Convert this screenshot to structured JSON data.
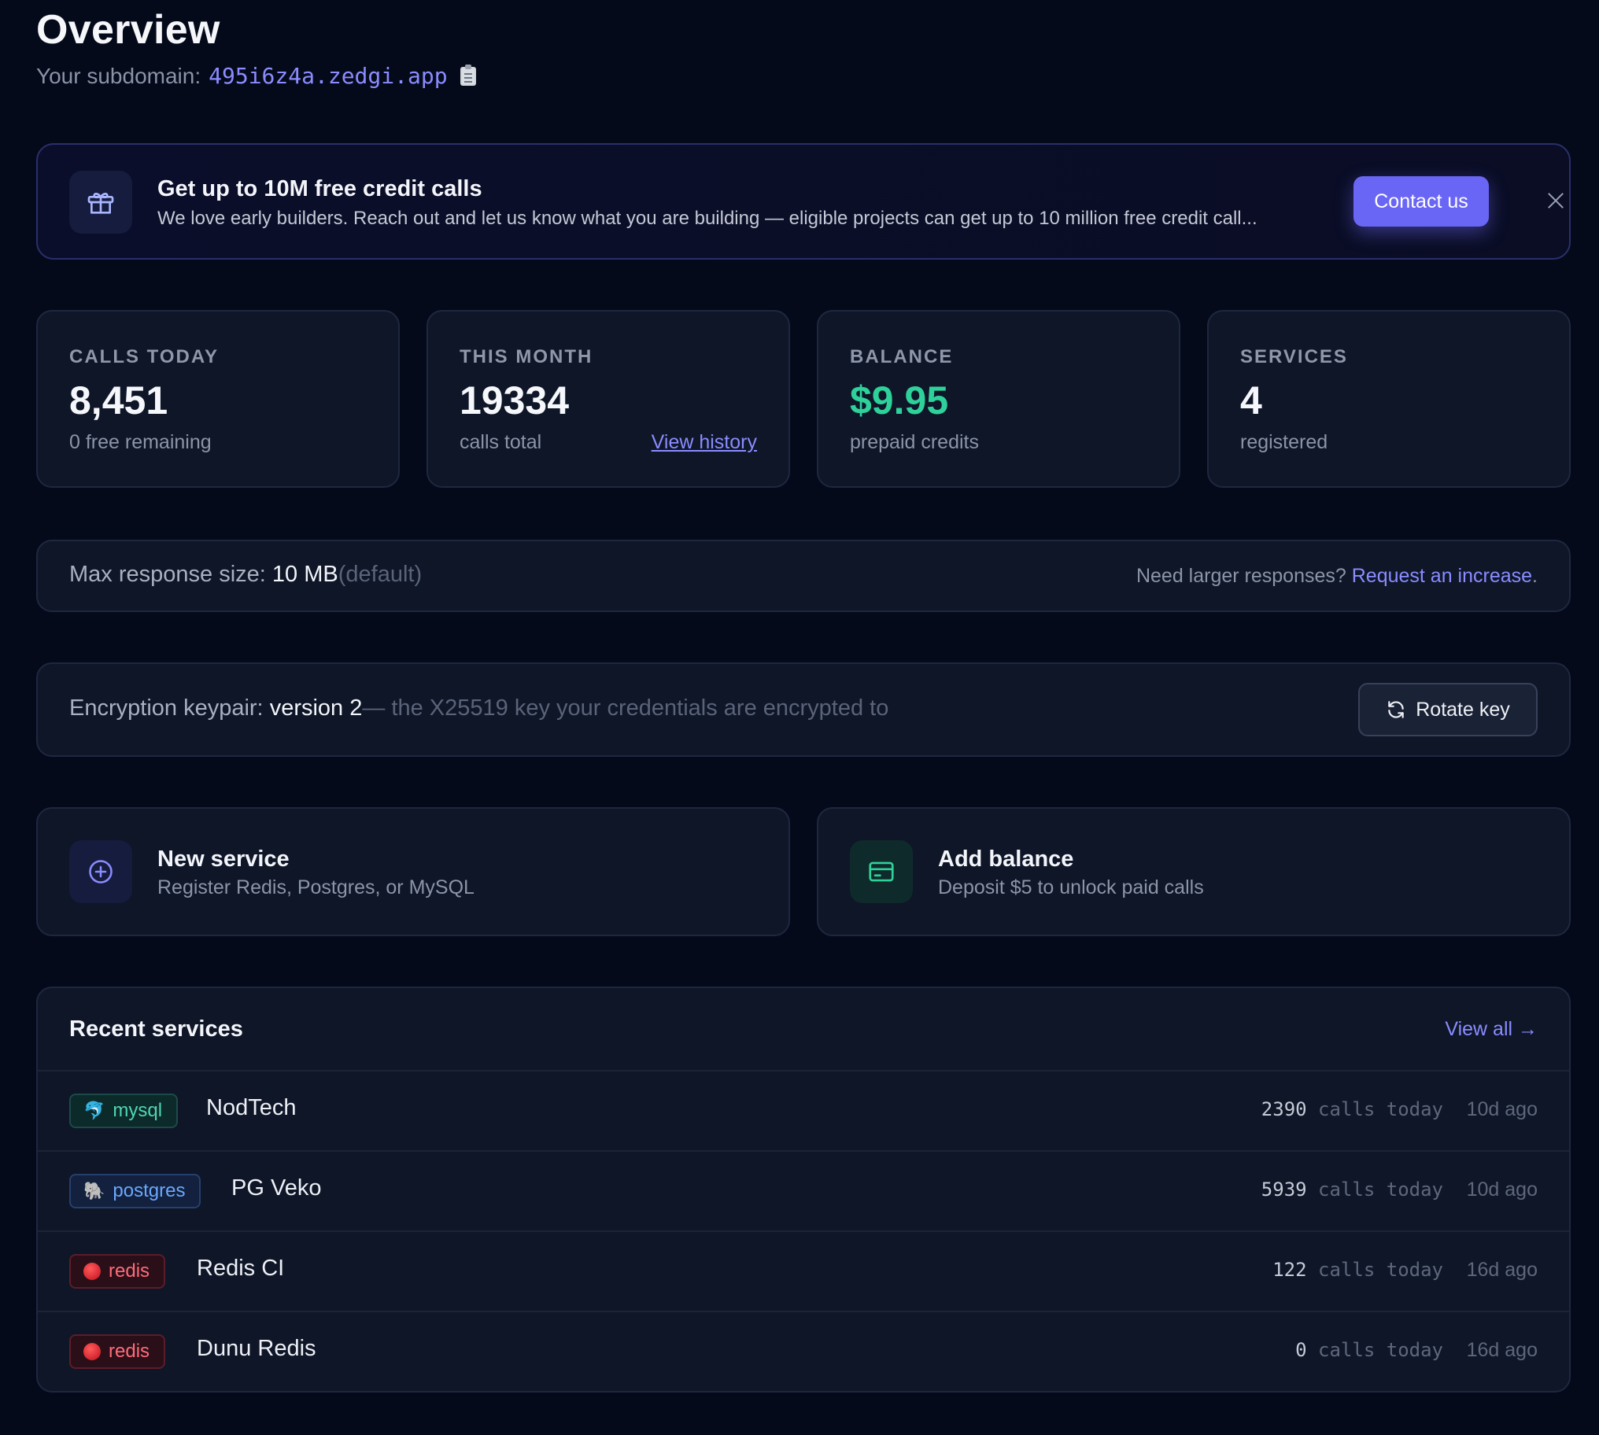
{
  "header": {
    "title": "Overview",
    "subdomain_label": "Your subdomain:",
    "subdomain": "495i6z4a.zedgi.app"
  },
  "promo": {
    "title": "Get up to 10M free credit calls",
    "text": "We love early builders. Reach out and let us know what you are building — eligible projects can get up to 10 million free credit call...",
    "button": "Contact us"
  },
  "stats": [
    {
      "label": "CALLS TODAY",
      "value": "8,451",
      "sub": "0 free remaining"
    },
    {
      "label": "THIS MONTH",
      "value": "19334",
      "sub": "calls total",
      "link": "View history"
    },
    {
      "label": "BALANCE",
      "value": "$9.95",
      "sub": "prepaid credits"
    },
    {
      "label": "SERVICES",
      "value": "4",
      "sub": "registered"
    }
  ],
  "response_size": {
    "label": "Max response size:",
    "value": "10 MB",
    "note": "(default)",
    "right_text": "Need larger responses?",
    "right_link": "Request an increase",
    "right_end": "."
  },
  "keypair": {
    "label": "Encryption keypair:",
    "value": "version 2",
    "note": "— the X25519 key your credentials are encrypted to",
    "button": "Rotate key"
  },
  "actions": [
    {
      "title": "New service",
      "sub": "Register Redis, Postgres, or MySQL",
      "icon": "plus-circle-icon"
    },
    {
      "title": "Add balance",
      "sub": "Deposit $5 to unlock paid calls",
      "icon": "credit-card-icon"
    }
  ],
  "recent": {
    "title": "Recent services",
    "view_all": "View all →",
    "calls_suffix": "calls today",
    "rows": [
      {
        "type": "mysql",
        "name": "NodTech",
        "calls": "2390",
        "ago": "10d ago"
      },
      {
        "type": "postgres",
        "name": "PG Veko",
        "calls": "5939",
        "ago": "10d ago"
      },
      {
        "type": "redis",
        "name": "Redis CI",
        "calls": "122",
        "ago": "16d ago"
      },
      {
        "type": "redis",
        "name": "Dunu Redis",
        "calls": "0",
        "ago": "16d ago"
      }
    ]
  },
  "colors": {
    "accent": "#6a66f5",
    "link": "#8a8cff",
    "balance": "#2fd19a",
    "background": "#050a1a"
  }
}
